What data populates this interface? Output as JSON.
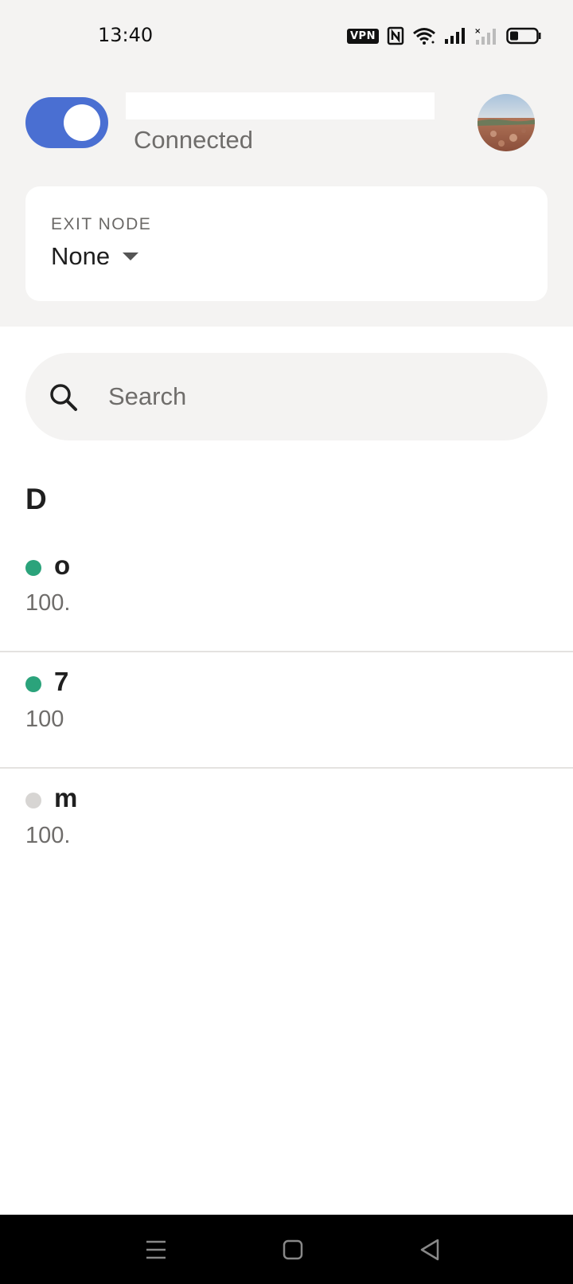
{
  "status_bar": {
    "time": "13:40",
    "vpn_badge": "VPN",
    "icons": [
      "vpn-icon",
      "nfc-icon",
      "wifi-icon",
      "signal-icon",
      "signal-no-sim-icon",
      "battery-icon"
    ]
  },
  "header": {
    "connection_status": "Connected",
    "toggle_on": true,
    "accent_color": "#4a6fd2"
  },
  "exit_node": {
    "label": "EXIT NODE",
    "value": "None"
  },
  "search": {
    "placeholder": "Search"
  },
  "devices": {
    "section_title": "D",
    "items": [
      {
        "name": "o",
        "ip": "100.",
        "status": "online"
      },
      {
        "name": "7",
        "ip": "100",
        "status": "online"
      },
      {
        "name": "m",
        "ip": "100.",
        "status": "offline"
      }
    ]
  },
  "colors": {
    "online": "#2ba37b",
    "offline": "#d7d5d3"
  },
  "nav_bar": {
    "icons": [
      "menu-icon",
      "home-icon",
      "back-icon"
    ]
  }
}
